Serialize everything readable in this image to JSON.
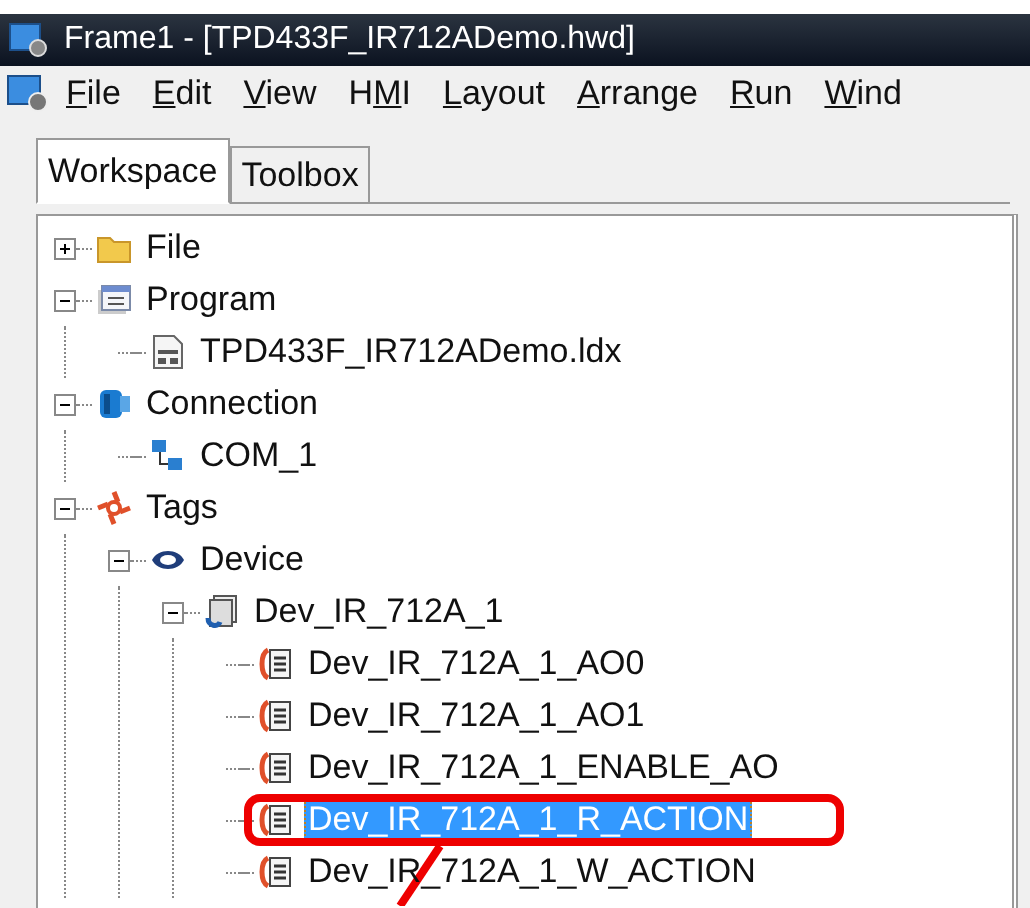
{
  "window": {
    "title": "Frame1 - [TPD433F_IR712ADemo.hwd]"
  },
  "menu": [
    {
      "access_key": "F",
      "rest": "ile"
    },
    {
      "access_key": "E",
      "rest": "dit"
    },
    {
      "access_key": "V",
      "rest": "iew"
    },
    {
      "lead": "H",
      "access_key": "M",
      "rest": "I"
    },
    {
      "access_key": "L",
      "rest": "ayout"
    },
    {
      "access_key": "A",
      "rest": "rrange"
    },
    {
      "access_key": "R",
      "rest": "un"
    },
    {
      "access_key": "W",
      "rest": "ind"
    }
  ],
  "tabs": [
    {
      "label": "Workspace",
      "selected": true
    },
    {
      "label": "Toolbox",
      "selected": false
    }
  ],
  "tree": [
    {
      "label": "File",
      "kind": "folder",
      "expanded": false,
      "selected": false,
      "annotated": false
    },
    {
      "label": "Program",
      "kind": "program",
      "expanded": true,
      "selected": false,
      "annotated": false,
      "children": [
        {
          "label": "TPD433F_IR712ADemo.ldx",
          "kind": "file",
          "selected": false,
          "annotated": false
        }
      ]
    },
    {
      "label": "Connection",
      "kind": "connection",
      "expanded": true,
      "selected": false,
      "annotated": false,
      "children": [
        {
          "label": "COM_1",
          "kind": "port",
          "selected": false,
          "annotated": false
        }
      ]
    },
    {
      "label": "Tags",
      "kind": "tags",
      "expanded": true,
      "selected": false,
      "annotated": false,
      "children": [
        {
          "label": "Device",
          "kind": "device",
          "expanded": true,
          "selected": false,
          "annotated": false,
          "children": [
            {
              "label": "Dev_IR_712A_1",
              "kind": "module",
              "expanded": true,
              "selected": false,
              "annotated": false,
              "children": [
                {
                  "label": "Dev_IR_712A_1_AO0",
                  "kind": "tag",
                  "selected": false,
                  "annotated": false
                },
                {
                  "label": "Dev_IR_712A_1_AO1",
                  "kind": "tag",
                  "selected": false,
                  "annotated": false
                },
                {
                  "label": "Dev_IR_712A_1_ENABLE_AO",
                  "kind": "tag",
                  "selected": false,
                  "annotated": false
                },
                {
                  "label": "Dev_IR_712A_1_R_ACTION",
                  "kind": "tag",
                  "selected": true,
                  "annotated": true
                },
                {
                  "label": "Dev_IR_712A_1_W_ACTION",
                  "kind": "tag",
                  "selected": false,
                  "annotated": false
                }
              ]
            }
          ]
        }
      ]
    }
  ]
}
